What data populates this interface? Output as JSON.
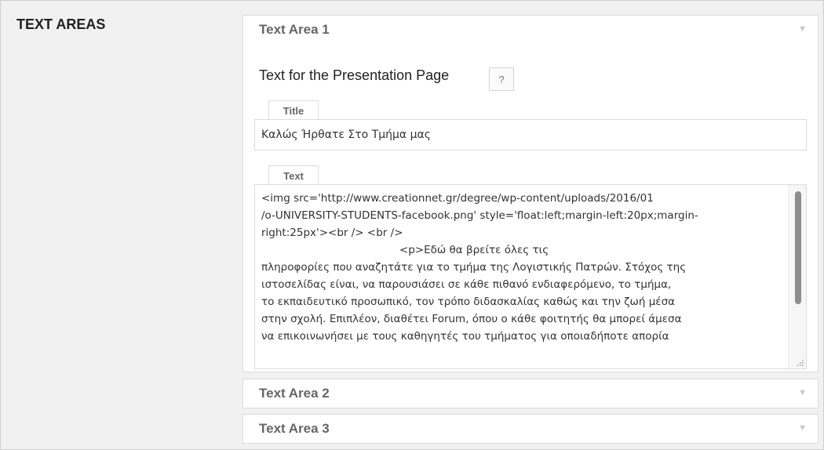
{
  "section": {
    "title": "TEXT AREAS"
  },
  "panels": [
    {
      "title": "Text Area 1",
      "expanded": true,
      "field_label": "Text for the Presentation Page",
      "help_label": "?",
      "title_tab": "Title",
      "title_value": "Καλώς Ήρθατε Στο Τμήμα μας",
      "text_tab": "Text",
      "text_value": "<img src='http://www.creationnet.gr/degree/wp-content/uploads/2016/01\n/o-UNIVERSITY-STUDENTS-facebook.png' style='float:left;margin-left:20px;margin-\nright:25px'><br /> <br />\n                                         <p>Εδώ θα βρείτε όλες τις\nπληροφορίες που αναζητάτε για το τμήμα της Λογιστικής Πατρών. Στόχος της\nιστοσελίδας είναι, να παρουσιάσει σε κάθε πιθανό ενδιαφερόμενο, το τμήμα,\nτο εκπαιδευτικό προσωπικό, τον τρόπο διδασκαλίας καθώς και την ζωή μέσα\nστην σχολή. Επιπλέον, διαθέτει Forum, όπου ο κάθε φοιτητής θα μπορεί άμεσα\nνα επικοινωνήσει με τους καθηγητές του τμήματος για οποιαδήποτε απορία"
    },
    {
      "title": "Text Area 2",
      "expanded": false
    },
    {
      "title": "Text Area 3",
      "expanded": false
    }
  ],
  "icons": {
    "collapse": "caret-down-icon",
    "help": "question-mark-icon",
    "resize": "resize-grip-icon"
  },
  "colors": {
    "background": "#f1f1f1",
    "panel": "#ffffff",
    "border": "#dcdcdc",
    "header_text": "#666666"
  }
}
